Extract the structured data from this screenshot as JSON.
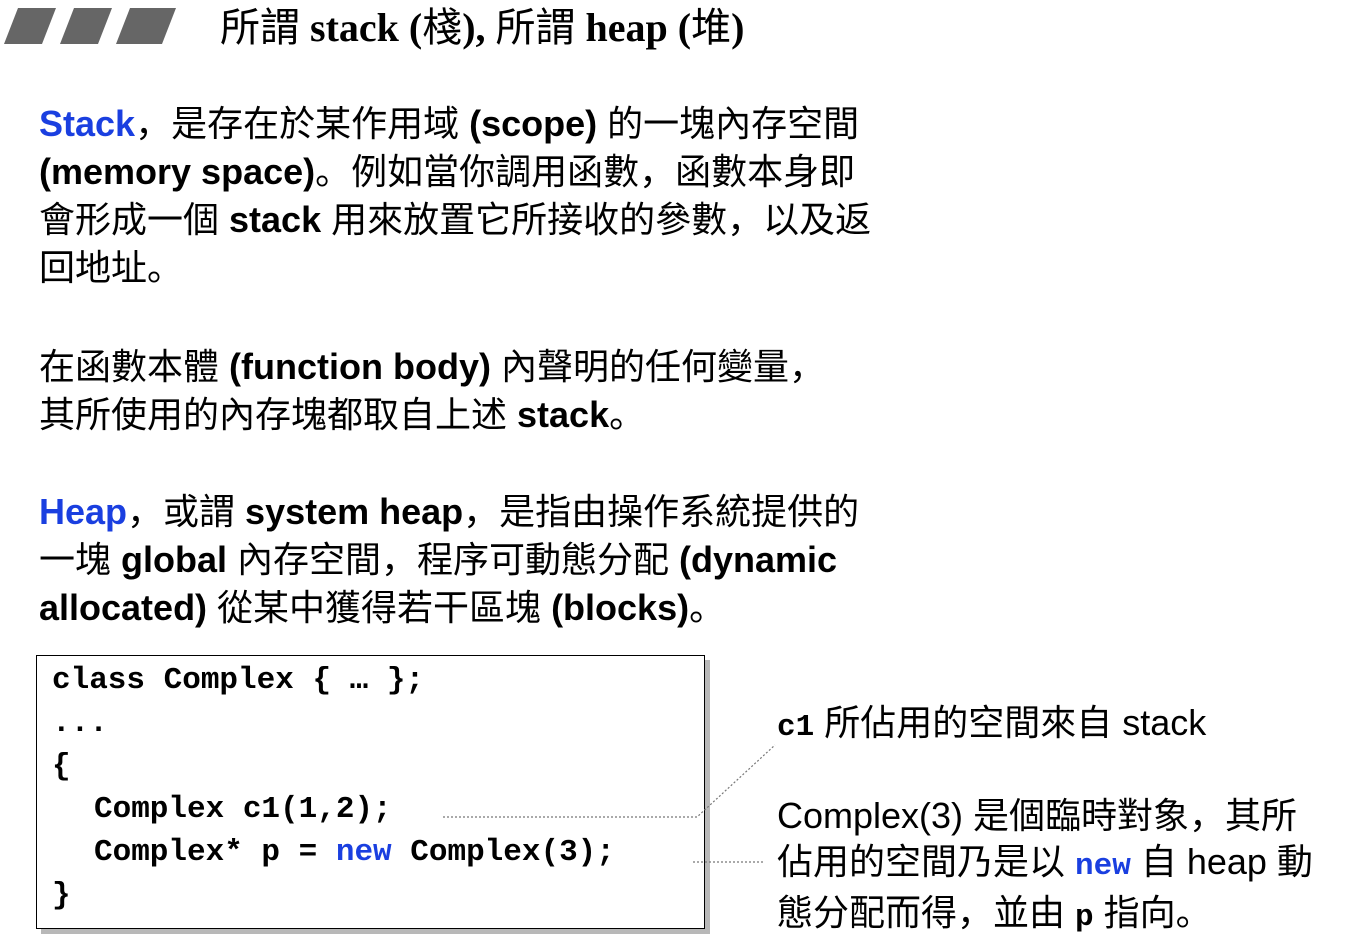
{
  "title": {
    "part1": "所謂",
    "part2": "stack (",
    "part3": "棧",
    "part4": "), ",
    "part5": "所謂",
    "part6": "heap (",
    "part7": "堆",
    "part8": ")"
  },
  "para_stack": {
    "line1": {
      "kw": "Stack",
      "t1": "，是存在於某作用域 ",
      "b1": "(scope)",
      "t2": " 的一塊內存空間"
    },
    "line2": {
      "b1": "(memory space)",
      "t1": "。例如當你調用函數，函數本身即"
    },
    "line3": {
      "t1": "會形成一個 ",
      "b1": "stack",
      "t2": " 用來放置它所接收的參數，以及返"
    },
    "line4": {
      "t1": "回地址。"
    }
  },
  "para_body": {
    "line1": {
      "t1": "在函數本體 ",
      "b1": "(function body)",
      "t2": " 內聲明的任何變量，"
    },
    "line2": {
      "t1": "其所使用的內存塊都取自上述 ",
      "b1": "stack",
      "t2": "。"
    }
  },
  "para_heap": {
    "line1": {
      "kw": "Heap",
      "t1": "，或謂 ",
      "b1": "system heap",
      "t2": "，是指由操作系統提供的"
    },
    "line2": {
      "t1": "一塊 ",
      "b1": "global",
      "t2": " 內存空間，程序可動態分配 ",
      "b2": "(dynamic"
    },
    "line3": {
      "b1": "allocated)",
      "t1": " 從某中獲得若干區塊 ",
      "b2": "(blocks)",
      "t2": "。"
    }
  },
  "code": {
    "line1": "class Complex { … };",
    "line2": "...",
    "line3": "{",
    "line4": "Complex c1(1,2);",
    "line5_a": "Complex* p = ",
    "line5_new": "new",
    "line5_b": " Complex(3);",
    "line6": "}"
  },
  "notes": {
    "n1": {
      "code": "c1",
      "t1": " 所佔用的空間來自 stack"
    },
    "n2": {
      "line1": "Complex(3) 是個臨時對象，其所",
      "line2_a": "佔用的空間乃是以 ",
      "line2_code": "new",
      "line2_b": " 自 heap 動",
      "line3_a": "態分配而得，並由 ",
      "line3_code": "p",
      "line3_b": " 指向。"
    }
  },
  "colors": {
    "keyword": "#1a3fe0",
    "deco": "#666666",
    "shadow": "#b8b8b8"
  },
  "icons": [
    "slide-stripe-icon"
  ]
}
